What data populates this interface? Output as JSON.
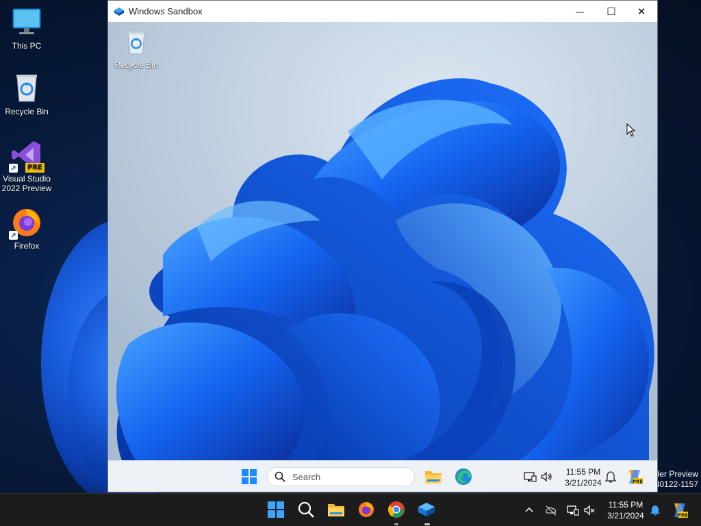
{
  "host_desktop": {
    "icons": [
      {
        "label": "This PC",
        "icon": "this-pc-icon"
      },
      {
        "label": "Recycle Bin",
        "icon": "recycle-bin-icon"
      },
      {
        "label": "Visual Studio 2022 Preview",
        "line1": "Visual Studio",
        "line2": "2022 Preview",
        "icon": "visual-studio-icon",
        "badge": "PRE"
      },
      {
        "label": "Firefox",
        "icon": "firefox-icon"
      }
    ],
    "watermark": {
      "line1": "der Preview",
      "line2": "40122-1157"
    }
  },
  "sandbox_window": {
    "title": "Windows Sandbox",
    "controls": {
      "minimize": "—",
      "maximize": "☐",
      "close": "✕"
    },
    "desktop_icons": [
      {
        "label": "Recycle Bin",
        "icon": "recycle-bin-icon"
      }
    ],
    "taskbar": {
      "search_placeholder": "Search",
      "pinned": [
        "start-icon",
        "file-explorer-icon",
        "edge-icon"
      ],
      "tray": [
        "network-icon",
        "volume-icon"
      ],
      "time": "11:55 PM",
      "date": "3/21/2024",
      "badge": "PRE"
    }
  },
  "host_taskbar": {
    "pinned": [
      "start-icon",
      "search-icon",
      "file-explorer-icon",
      "firefox-icon",
      "chrome-icon",
      "sandbox-icon"
    ],
    "tray": [
      "chevron-up-icon",
      "cloud-offline-icon",
      "network-icon",
      "volume-muted-icon"
    ],
    "time": "11:55 PM",
    "date": "3/21/2024",
    "badge": "PRE"
  },
  "colors": {
    "accent": "#0067c0",
    "bloom": "#1a5fe0",
    "host_taskbar": "#1c1c1c",
    "sandbox_taskbar": "#eef1f6"
  }
}
